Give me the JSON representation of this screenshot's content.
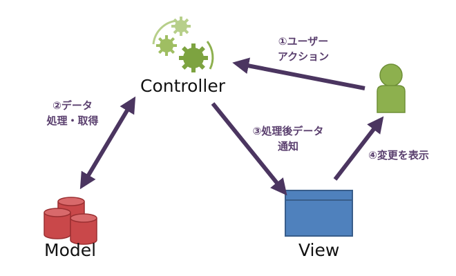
{
  "nodes": {
    "controller": {
      "label": "Controller"
    },
    "model": {
      "label": "Model"
    },
    "view": {
      "label": "View"
    }
  },
  "edges": {
    "user_action": {
      "line1": "①ユーザー",
      "line2": "アクション"
    },
    "data_processing": {
      "line1": "②データ",
      "line2": "処理・取得"
    },
    "notify": {
      "line1": "③処理後データ",
      "line2": "通知"
    },
    "display_change": {
      "line1": "④変更を表示"
    }
  },
  "colors": {
    "arrow": "#4b3560",
    "label": "#5a3f6e",
    "gear": "#8db04e",
    "gear_light": "#b7cf8a",
    "user": "#8db04e",
    "database": "#c9484a",
    "view_window": "#4f81bd"
  },
  "icons": {
    "controller": "gears-icon",
    "model": "database-icon",
    "view": "window-icon",
    "user": "user-icon"
  }
}
